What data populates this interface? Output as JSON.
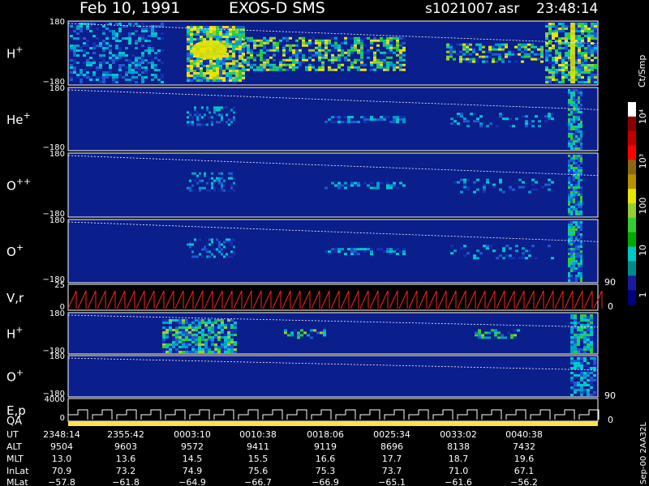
{
  "header": {
    "date": "Feb 10, 1991",
    "mission": "EXOS-D SMS",
    "file": "s1021007.asr",
    "time": "23:48:14"
  },
  "panels": [
    {
      "label_main": "H",
      "label_sup": "+",
      "ytop": "180",
      "ybot": "−180"
    },
    {
      "label_main": "He",
      "label_sup": "+",
      "ytop": "180",
      "ybot": "−180"
    },
    {
      "label_main": "O",
      "label_sup": "++",
      "ytop": "180",
      "ybot": "−180"
    },
    {
      "label_main": "O",
      "label_sup": "+",
      "ytop": "180",
      "ybot": "−180"
    },
    {
      "label_main": "V,r",
      "label_sup": "",
      "ytop": "25",
      "ybot": "0"
    },
    {
      "label_main": "H",
      "label_sup": "+",
      "ytop": "180",
      "ybot": "−180"
    },
    {
      "label_main": "O",
      "label_sup": "+",
      "ytop": "180",
      "ybot": "−180"
    },
    {
      "label_main": "E,p",
      "label_sup": "",
      "ytop": "4000",
      "ybot": "0"
    }
  ],
  "qa_label": "QA",
  "right_axis": {
    "v1": "90",
    "v2": "0",
    "v3": "90",
    "v4": "0"
  },
  "colorbar": {
    "title": "Ct/Smp",
    "ticks": [
      "10⁴",
      "10³",
      "100",
      "10",
      "1"
    ],
    "colors": [
      "#ffffff",
      "#8b0000",
      "#c00000",
      "#ff0000",
      "#8b6914",
      "#b89000",
      "#e6e600",
      "#9acd32",
      "#32cd32",
      "#00aa00",
      "#00c8c8",
      "#008b8b",
      "#1a1aa0",
      "#000080"
    ]
  },
  "table": {
    "row_labels": [
      "UT",
      "ALT",
      "MLT",
      "InLat",
      "MLat"
    ],
    "columns": [
      [
        "2348:14",
        "9504",
        "13.0",
        "70.9",
        "−57.8"
      ],
      [
        "2355:42",
        "9603",
        "13.6",
        "73.2",
        "−61.8"
      ],
      [
        "0003:10",
        "9572",
        "14.5",
        "74.9",
        "−64.9"
      ],
      [
        "0010:38",
        "9411",
        "15.5",
        "75.6",
        "−66.7"
      ],
      [
        "0018:06",
        "9119",
        "16.6",
        "75.3",
        "−66.9"
      ],
      [
        "0025:34",
        "8696",
        "17.7",
        "73.7",
        "−65.1"
      ],
      [
        "0033:02",
        "8138",
        "18.7",
        "71.0",
        "−61.6"
      ],
      [
        "0040:38",
        "7432",
        "19.6",
        "67.1",
        "−56.2"
      ]
    ]
  },
  "side_label": "Sep-00  2AA32L",
  "chart_data": {
    "type": "heatmap",
    "title": "Feb 10, 1991   EXOS-D SMS",
    "x_ticks": [
      "2348:14",
      "2355:42",
      "0003:10",
      "0010:38",
      "0018:06",
      "0025:34",
      "0033:02",
      "0040:38"
    ],
    "series": [
      {
        "name": "H+",
        "ylim": [
          -180,
          180
        ]
      },
      {
        "name": "He+",
        "ylim": [
          -180,
          180
        ]
      },
      {
        "name": "O++",
        "ylim": [
          -180,
          180
        ]
      },
      {
        "name": "O+",
        "ylim": [
          -180,
          180
        ]
      },
      {
        "name": "V,r",
        "ylim": [
          0,
          25
        ]
      },
      {
        "name": "H+",
        "ylim": [
          -180,
          180
        ]
      },
      {
        "name": "O+",
        "ylim": [
          -180,
          180
        ]
      },
      {
        "name": "E,p",
        "ylim": [
          0,
          4000
        ]
      }
    ],
    "colorbar_range": [
      1,
      10000
    ],
    "colorbar_scale": "log"
  }
}
